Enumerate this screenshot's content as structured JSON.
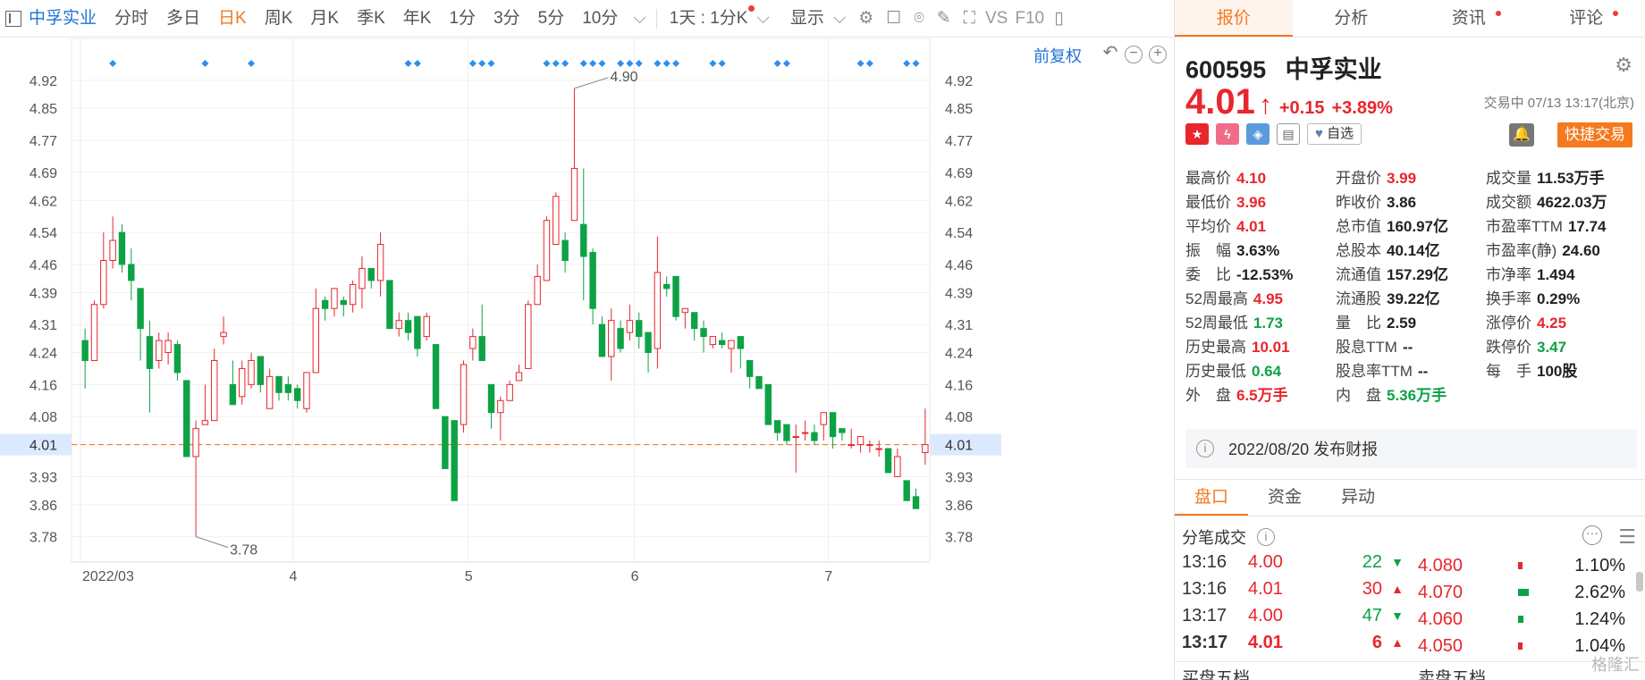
{
  "toolbar": {
    "stock_name": "中孚实业",
    "items": [
      "分时",
      "多日",
      "日K",
      "周K",
      "月K",
      "季K",
      "年K",
      "1分",
      "3分",
      "5分",
      "10分"
    ],
    "active_index": 2,
    "period_select": "1天 : 1分K",
    "display_menu": "显示",
    "vs_label": "VS",
    "f10_label": "F10"
  },
  "chart": {
    "fuquan_label": "前复权",
    "last_price_label": "4.01",
    "high_label": "4.90",
    "low_label": "3.78",
    "month_labels": [
      "2022/03",
      "4",
      "5",
      "6",
      "7"
    ]
  },
  "chart_data": {
    "type": "candlestick",
    "title": "",
    "xlabel": "",
    "ylabel": "",
    "ylim": [
      3.73,
      4.98
    ],
    "y_ticks": [
      4.92,
      4.85,
      4.77,
      4.69,
      4.62,
      4.54,
      4.46,
      4.39,
      4.31,
      4.24,
      4.16,
      4.08,
      4.01,
      3.93,
      3.86,
      3.78
    ],
    "x_month_ticks": [
      {
        "label": "2022/03",
        "index": 0
      },
      {
        "label": "4",
        "index": 23
      },
      {
        "label": "5",
        "index": 42
      },
      {
        "label": "6",
        "index": 60
      },
      {
        "label": "7",
        "index": 81
      }
    ],
    "current_price": 4.01,
    "high_annotation": 4.9,
    "low_annotation": 3.78,
    "event_marker_indices": [
      3,
      13,
      18,
      35,
      36,
      42,
      43,
      44,
      50,
      51,
      52,
      54,
      55,
      56,
      58,
      59,
      60,
      62,
      63,
      64,
      68,
      69,
      75,
      76,
      84,
      85,
      89,
      90
    ],
    "candles": [
      {
        "o": 4.27,
        "h": 4.3,
        "l": 4.15,
        "c": 4.22
      },
      {
        "o": 4.22,
        "h": 4.37,
        "l": 4.22,
        "c": 4.36
      },
      {
        "o": 4.36,
        "h": 4.54,
        "l": 4.35,
        "c": 4.47
      },
      {
        "o": 4.47,
        "h": 4.58,
        "l": 4.45,
        "c": 4.52
      },
      {
        "o": 4.54,
        "h": 4.56,
        "l": 4.44,
        "c": 4.46
      },
      {
        "o": 4.46,
        "h": 4.5,
        "l": 4.37,
        "c": 4.42
      },
      {
        "o": 4.4,
        "h": 4.4,
        "l": 4.22,
        "c": 4.3
      },
      {
        "o": 4.28,
        "h": 4.32,
        "l": 4.09,
        "c": 4.2
      },
      {
        "o": 4.22,
        "h": 4.29,
        "l": 4.2,
        "c": 4.27
      },
      {
        "o": 4.24,
        "h": 4.29,
        "l": 4.21,
        "c": 4.27
      },
      {
        "o": 4.26,
        "h": 4.27,
        "l": 4.17,
        "c": 4.19
      },
      {
        "o": 4.17,
        "h": 4.17,
        "l": 3.98,
        "c": 3.98
      },
      {
        "o": 3.98,
        "h": 4.07,
        "l": 3.78,
        "c": 4.05
      },
      {
        "o": 4.06,
        "h": 4.16,
        "l": 4.06,
        "c": 4.07
      },
      {
        "o": 4.07,
        "h": 4.25,
        "l": 4.07,
        "c": 4.22
      },
      {
        "o": 4.28,
        "h": 4.33,
        "l": 4.26,
        "c": 4.29
      },
      {
        "o": 4.16,
        "h": 4.22,
        "l": 4.11,
        "c": 4.11
      },
      {
        "o": 4.13,
        "h": 4.22,
        "l": 4.11,
        "c": 4.2
      },
      {
        "o": 4.16,
        "h": 4.24,
        "l": 4.15,
        "c": 4.22
      },
      {
        "o": 4.23,
        "h": 4.23,
        "l": 4.14,
        "c": 4.16
      },
      {
        "o": 4.1,
        "h": 4.2,
        "l": 4.1,
        "c": 4.18
      },
      {
        "o": 4.18,
        "h": 4.18,
        "l": 4.12,
        "c": 4.14
      },
      {
        "o": 4.16,
        "h": 4.18,
        "l": 4.12,
        "c": 4.14
      },
      {
        "o": 4.15,
        "h": 4.16,
        "l": 4.1,
        "c": 4.12
      },
      {
        "o": 4.1,
        "h": 4.19,
        "l": 4.09,
        "c": 4.19
      },
      {
        "o": 4.19,
        "h": 4.4,
        "l": 4.19,
        "c": 4.35
      },
      {
        "o": 4.37,
        "h": 4.38,
        "l": 4.32,
        "c": 4.35
      },
      {
        "o": 4.35,
        "h": 4.4,
        "l": 4.33,
        "c": 4.4
      },
      {
        "o": 4.37,
        "h": 4.38,
        "l": 4.33,
        "c": 4.36
      },
      {
        "o": 4.36,
        "h": 4.42,
        "l": 4.34,
        "c": 4.41
      },
      {
        "o": 4.4,
        "h": 4.48,
        "l": 4.35,
        "c": 4.45
      },
      {
        "o": 4.45,
        "h": 4.45,
        "l": 4.4,
        "c": 4.42
      },
      {
        "o": 4.42,
        "h": 4.54,
        "l": 4.38,
        "c": 4.51
      },
      {
        "o": 4.42,
        "h": 4.42,
        "l": 4.3,
        "c": 4.3
      },
      {
        "o": 4.3,
        "h": 4.34,
        "l": 4.28,
        "c": 4.32
      },
      {
        "o": 4.32,
        "h": 4.34,
        "l": 4.27,
        "c": 4.29
      },
      {
        "o": 4.33,
        "h": 4.33,
        "l": 4.23,
        "c": 4.25
      },
      {
        "o": 4.28,
        "h": 4.34,
        "l": 4.27,
        "c": 4.33
      },
      {
        "o": 4.26,
        "h": 4.26,
        "l": 4.1,
        "c": 4.1
      },
      {
        "o": 4.08,
        "h": 4.08,
        "l": 3.95,
        "c": 3.95
      },
      {
        "o": 4.07,
        "h": 4.07,
        "l": 3.87,
        "c": 3.87
      },
      {
        "o": 4.06,
        "h": 4.22,
        "l": 4.04,
        "c": 4.21
      },
      {
        "o": 4.25,
        "h": 4.3,
        "l": 4.22,
        "c": 4.28
      },
      {
        "o": 4.28,
        "h": 4.36,
        "l": 4.22,
        "c": 4.22
      },
      {
        "o": 4.16,
        "h": 4.16,
        "l": 4.05,
        "c": 4.09
      },
      {
        "o": 4.09,
        "h": 4.13,
        "l": 4.02,
        "c": 4.12
      },
      {
        "o": 4.12,
        "h": 4.17,
        "l": 4.12,
        "c": 4.16
      },
      {
        "o": 4.17,
        "h": 4.21,
        "l": 4.17,
        "c": 4.19
      },
      {
        "o": 4.2,
        "h": 4.37,
        "l": 4.2,
        "c": 4.36
      },
      {
        "o": 4.36,
        "h": 4.46,
        "l": 4.36,
        "c": 4.43
      },
      {
        "o": 4.42,
        "h": 4.58,
        "l": 4.42,
        "c": 4.57
      },
      {
        "o": 4.51,
        "h": 4.64,
        "l": 4.51,
        "c": 4.63
      },
      {
        "o": 4.52,
        "h": 4.54,
        "l": 4.44,
        "c": 4.47
      },
      {
        "o": 4.57,
        "h": 4.9,
        "l": 4.57,
        "c": 4.7
      },
      {
        "o": 4.56,
        "h": 4.7,
        "l": 4.37,
        "c": 4.48
      },
      {
        "o": 4.49,
        "h": 4.5,
        "l": 4.31,
        "c": 4.35
      },
      {
        "o": 4.31,
        "h": 4.33,
        "l": 4.23,
        "c": 4.23
      },
      {
        "o": 4.23,
        "h": 4.35,
        "l": 4.17,
        "c": 4.32
      },
      {
        "o": 4.3,
        "h": 4.32,
        "l": 4.24,
        "c": 4.25
      },
      {
        "o": 4.29,
        "h": 4.36,
        "l": 4.27,
        "c": 4.32
      },
      {
        "o": 4.32,
        "h": 4.34,
        "l": 4.25,
        "c": 4.28
      },
      {
        "o": 4.29,
        "h": 4.29,
        "l": 4.19,
        "c": 4.24
      },
      {
        "o": 4.25,
        "h": 4.53,
        "l": 4.2,
        "c": 4.44
      },
      {
        "o": 4.41,
        "h": 4.43,
        "l": 4.38,
        "c": 4.4
      },
      {
        "o": 4.43,
        "h": 4.43,
        "l": 4.32,
        "c": 4.33
      },
      {
        "o": 4.34,
        "h": 4.35,
        "l": 4.3,
        "c": 4.35
      },
      {
        "o": 4.34,
        "h": 4.34,
        "l": 4.27,
        "c": 4.3
      },
      {
        "o": 4.3,
        "h": 4.32,
        "l": 4.24,
        "c": 4.28
      },
      {
        "o": 4.26,
        "h": 4.28,
        "l": 4.25,
        "c": 4.28
      },
      {
        "o": 4.27,
        "h": 4.29,
        "l": 4.25,
        "c": 4.26
      },
      {
        "o": 4.25,
        "h": 4.27,
        "l": 4.19,
        "c": 4.27
      },
      {
        "o": 4.28,
        "h": 4.28,
        "l": 4.2,
        "c": 4.25
      },
      {
        "o": 4.22,
        "h": 4.22,
        "l": 4.15,
        "c": 4.18
      },
      {
        "o": 4.18,
        "h": 4.18,
        "l": 4.15,
        "c": 4.15
      },
      {
        "o": 4.16,
        "h": 4.16,
        "l": 4.06,
        "c": 4.06
      },
      {
        "o": 4.07,
        "h": 4.07,
        "l": 4.02,
        "c": 4.04
      },
      {
        "o": 4.06,
        "h": 4.06,
        "l": 4.01,
        "c": 4.02
      },
      {
        "o": 4.03,
        "h": 4.06,
        "l": 3.94,
        "c": 4.03
      },
      {
        "o": 4.04,
        "h": 4.07,
        "l": 4.02,
        "c": 4.04
      },
      {
        "o": 4.04,
        "h": 4.06,
        "l": 4.01,
        "c": 4.02
      },
      {
        "o": 4.06,
        "h": 4.09,
        "l": 4.02,
        "c": 4.09
      },
      {
        "o": 4.09,
        "h": 4.09,
        "l": 4.0,
        "c": 4.03
      },
      {
        "o": 4.05,
        "h": 4.05,
        "l": 4.02,
        "c": 4.04
      },
      {
        "o": 4.01,
        "h": 4.05,
        "l": 4.0,
        "c": 4.01
      },
      {
        "o": 4.01,
        "h": 4.03,
        "l": 3.99,
        "c": 4.03
      },
      {
        "o": 4.01,
        "h": 4.02,
        "l": 3.99,
        "c": 4.01
      },
      {
        "o": 4.0,
        "h": 4.02,
        "l": 3.98,
        "c": 4.0
      },
      {
        "o": 4.0,
        "h": 4.0,
        "l": 3.94,
        "c": 3.94
      },
      {
        "o": 3.93,
        "h": 4.0,
        "l": 3.93,
        "c": 3.98
      },
      {
        "o": 3.92,
        "h": 3.92,
        "l": 3.87,
        "c": 3.87
      },
      {
        "o": 3.88,
        "h": 3.9,
        "l": 3.85,
        "c": 3.85
      },
      {
        "o": 3.99,
        "h": 4.1,
        "l": 3.96,
        "c": 4.01
      }
    ]
  },
  "panel": {
    "tabs": [
      "报价",
      "分析",
      "资讯",
      "评论"
    ],
    "code": "600595",
    "name": "中孚实业",
    "price": "4.01",
    "change": "+0.15",
    "change_pct": "+3.89%",
    "status": "交易中 07/13 13:17(北京)",
    "zixuan_label": "自选",
    "quick_trade_label": "快捷交易",
    "quotes": [
      [
        {
          "l": "最高价",
          "v": "4.10",
          "c": "up"
        },
        {
          "l": "开盘价",
          "v": "3.99",
          "c": "up"
        },
        {
          "l": "成交量",
          "v": "11.53万手",
          "c": "neu"
        }
      ],
      [
        {
          "l": "最低价",
          "v": "3.96",
          "c": "up"
        },
        {
          "l": "昨收价",
          "v": "3.86",
          "c": "neu"
        },
        {
          "l": "成交额",
          "v": "4622.03万",
          "c": "neu"
        }
      ],
      [
        {
          "l": "平均价",
          "v": "4.01",
          "c": "up"
        },
        {
          "l": "总市值",
          "v": "160.97亿",
          "c": "neu"
        },
        {
          "l": "市盈率TTM",
          "v": "17.74",
          "c": "neu"
        }
      ],
      [
        {
          "l": "振　幅",
          "v": "3.63%",
          "c": "neu"
        },
        {
          "l": "总股本",
          "v": "40.14亿",
          "c": "neu"
        },
        {
          "l": "市盈率(静)",
          "v": "24.60",
          "c": "neu"
        }
      ],
      [
        {
          "l": "委　比",
          "v": "-12.53%",
          "c": "neu"
        },
        {
          "l": "流通值",
          "v": "157.29亿",
          "c": "neu"
        },
        {
          "l": "市净率",
          "v": "1.494",
          "c": "neu"
        }
      ],
      [
        {
          "l": "52周最高",
          "v": "4.95",
          "c": "up"
        },
        {
          "l": "流通股",
          "v": "39.22亿",
          "c": "neu"
        },
        {
          "l": "换手率",
          "v": "0.29%",
          "c": "neu"
        }
      ],
      [
        {
          "l": "52周最低",
          "v": "1.73",
          "c": "down"
        },
        {
          "l": "量　比",
          "v": "2.59",
          "c": "neu"
        },
        {
          "l": "涨停价",
          "v": "4.25",
          "c": "up"
        }
      ],
      [
        {
          "l": "历史最高",
          "v": "10.01",
          "c": "up"
        },
        {
          "l": "股息TTM",
          "v": "--",
          "c": "neu"
        },
        {
          "l": "跌停价",
          "v": "3.47",
          "c": "down"
        }
      ],
      [
        {
          "l": "历史最低",
          "v": "0.64",
          "c": "down"
        },
        {
          "l": "股息率TTM",
          "v": "--",
          "c": "neu"
        },
        {
          "l": "每　手",
          "v": "100股",
          "c": "neu"
        }
      ],
      [
        {
          "l": "外　盘",
          "v": "6.5万手",
          "c": "up"
        },
        {
          "l": "内　盘",
          "v": "5.36万手",
          "c": "down"
        },
        {
          "l": "",
          "v": "",
          "c": "neu"
        }
      ]
    ],
    "notice": "2022/08/20  发布财报",
    "subtabs": [
      "盘口",
      "资金",
      "异动"
    ],
    "ticks_title": "分笔成交",
    "ticks": [
      {
        "t": "13:16",
        "p": "4.00",
        "v": "22",
        "d": "down"
      },
      {
        "t": "13:16",
        "p": "4.01",
        "v": "30",
        "d": "up"
      },
      {
        "t": "13:17",
        "p": "4.00",
        "v": "47",
        "d": "down"
      },
      {
        "t": "13:17",
        "p": "4.01",
        "v": "6",
        "d": "up"
      }
    ],
    "depth": [
      {
        "p": "4.080",
        "r": "1.10%",
        "level": 0.1,
        "g": false
      },
      {
        "p": "4.070",
        "r": "2.62%",
        "level": 0.24,
        "g": true
      },
      {
        "p": "4.060",
        "r": "1.24%",
        "level": 0.11,
        "g": true
      },
      {
        "p": "4.050",
        "r": "1.04%",
        "level": 0.09,
        "g": false
      }
    ],
    "bottom_left": "买盘五档",
    "bottom_right": "卖盘五档",
    "watermark": "格隆汇"
  }
}
